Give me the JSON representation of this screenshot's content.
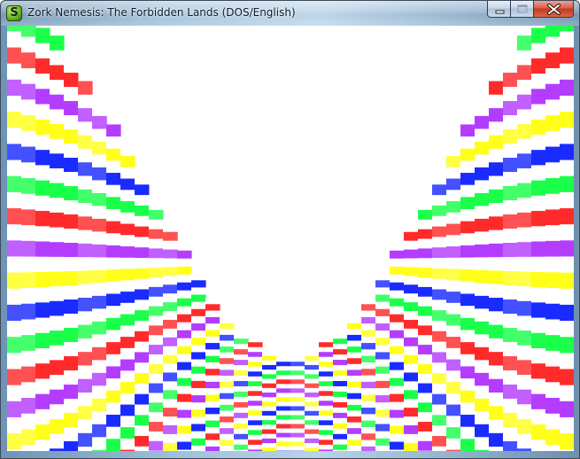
{
  "window": {
    "title": "Zork Nemesis: The Forbidden Lands (DOS/English)",
    "icon": "s-logo-icon",
    "buttons": [
      "minimize-icon",
      "maximize-icon",
      "close-icon"
    ]
  },
  "game_view": {
    "pattern": "warped-rainbow-stripes",
    "palette": [
      "#ff2b2b",
      "#ffffff",
      "#b43cff",
      "#ffffff",
      "#ffff1a",
      "#ffffff",
      "#1a2bff",
      "#ffffff",
      "#1aff4a",
      "#ffffff"
    ]
  }
}
